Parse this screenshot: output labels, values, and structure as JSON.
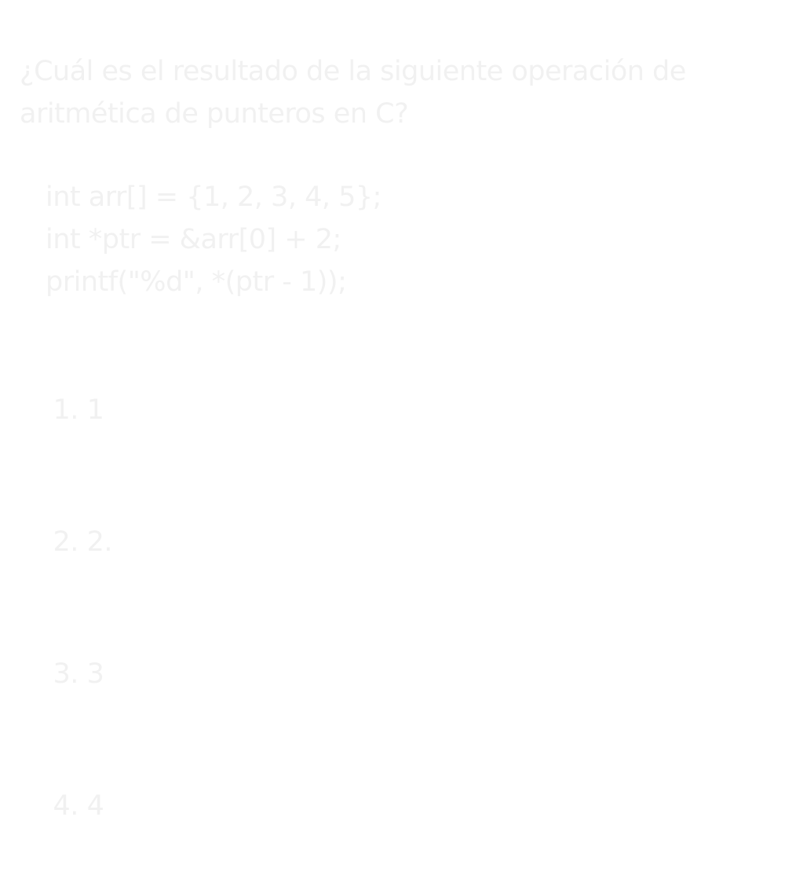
{
  "question": {
    "line1": "¿Cuál es el resultado de la siguiente operación de",
    "line2": "aritmética de punteros en C?"
  },
  "code": [
    "int arr[] = {1, 2, 3, 4, 5};",
    "int *ptr = &arr[0] + 2;",
    "printf(\"%d\", *(ptr - 1));"
  ],
  "options": [
    {
      "number": "1.",
      "value": "1"
    },
    {
      "number": "2.",
      "value": "2."
    },
    {
      "number": "3.",
      "value": "3"
    },
    {
      "number": "4.",
      "value": "4"
    }
  ]
}
